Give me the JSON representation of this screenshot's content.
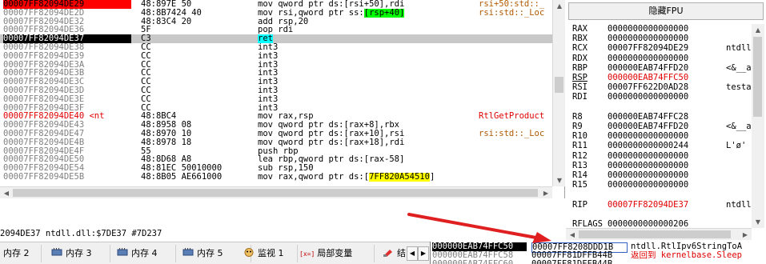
{
  "disasm": {
    "rows": [
      {
        "addr": "00007FF82094DE29",
        "bytes": "48:897E 50",
        "ins": [
          {
            "t": "mov qword ptr ds:[rsi+50],rdi"
          }
        ],
        "cmt": "rsi+50:std::_",
        "style": "bp"
      },
      {
        "addr": "00007FF82094DE2D",
        "bytes": "48:8B7424 40",
        "ins": [
          {
            "t": "mov rsi,qword ptr ss:"
          },
          {
            "t": "[rsp+40]",
            "hl": "green"
          }
        ],
        "cmt": "rsi:std::_Loc",
        "style": "normal"
      },
      {
        "addr": "00007FF82094DE32",
        "bytes": "48:83C4 20",
        "ins": [
          {
            "t": "add rsp,20"
          }
        ],
        "cmt": "",
        "style": "normal"
      },
      {
        "addr": "00007FF82094DE36",
        "bytes": "5F",
        "ins": [
          {
            "t": "pop rdi"
          }
        ],
        "cmt": "",
        "style": "normal"
      },
      {
        "addr": "00007FF82094DE37",
        "bytes": "C3",
        "ins": [
          {
            "t": "ret",
            "hl": "cyan"
          }
        ],
        "cmt": "",
        "style": "current"
      },
      {
        "addr": "00007FF82094DE38",
        "bytes": "CC",
        "ins": [
          {
            "t": "int3"
          }
        ],
        "cmt": "",
        "style": "normal"
      },
      {
        "addr": "00007FF82094DE39",
        "bytes": "CC",
        "ins": [
          {
            "t": "int3"
          }
        ],
        "cmt": "",
        "style": "normal"
      },
      {
        "addr": "00007FF82094DE3A",
        "bytes": "CC",
        "ins": [
          {
            "t": "int3"
          }
        ],
        "cmt": "",
        "style": "normal"
      },
      {
        "addr": "00007FF82094DE3B",
        "bytes": "CC",
        "ins": [
          {
            "t": "int3"
          }
        ],
        "cmt": "",
        "style": "normal"
      },
      {
        "addr": "00007FF82094DE3C",
        "bytes": "CC",
        "ins": [
          {
            "t": "int3"
          }
        ],
        "cmt": "",
        "style": "normal"
      },
      {
        "addr": "00007FF82094DE3D",
        "bytes": "CC",
        "ins": [
          {
            "t": "int3"
          }
        ],
        "cmt": "",
        "style": "normal"
      },
      {
        "addr": "00007FF82094DE3E",
        "bytes": "CC",
        "ins": [
          {
            "t": "int3"
          }
        ],
        "cmt": "",
        "style": "normal"
      },
      {
        "addr": "00007FF82094DE3F",
        "bytes": "CC",
        "ins": [
          {
            "t": "int3"
          }
        ],
        "cmt": "",
        "style": "normal"
      },
      {
        "addr": "00007FF82094DE40 <nt",
        "bytes": "48:8BC4",
        "ins": [
          {
            "t": "mov rax,rsp"
          }
        ],
        "cmt": "RtlGetProduct",
        "style": "label"
      },
      {
        "addr": "00007FF82094DE43",
        "bytes": "48:8958 08",
        "ins": [
          {
            "t": "mov qword ptr ds:[rax+8],rbx"
          }
        ],
        "cmt": "",
        "style": "normal"
      },
      {
        "addr": "00007FF82094DE47",
        "bytes": "48:8970 10",
        "ins": [
          {
            "t": "mov qword ptr ds:[rax+10],rsi"
          }
        ],
        "cmt": "rsi:std::_Loc",
        "style": "normal"
      },
      {
        "addr": "00007FF82094DE4B",
        "bytes": "48:8978 18",
        "ins": [
          {
            "t": "mov qword ptr ds:[rax+18],rdi"
          }
        ],
        "cmt": "",
        "style": "normal"
      },
      {
        "addr": "00007FF82094DE4F",
        "bytes": "55",
        "ins": [
          {
            "t": "push rbp"
          }
        ],
        "cmt": "",
        "style": "normal"
      },
      {
        "addr": "00007FF82094DE50",
        "bytes": "48:8D68 A8",
        "ins": [
          {
            "t": "lea rbp,qword ptr ds:[rax-58]"
          }
        ],
        "cmt": "",
        "style": "normal"
      },
      {
        "addr": "00007FF82094DE54",
        "bytes": "48:81EC 50010000",
        "ins": [
          {
            "t": "sub rsp,150"
          }
        ],
        "cmt": "",
        "style": "normal"
      },
      {
        "addr": "00007FF82094DE5B",
        "bytes": "48:8B05 AE661000",
        "ins": [
          {
            "t": "mov rax,qword ptr ds:["
          },
          {
            "t": "7FF820A54510",
            "hl": "yellow"
          },
          {
            "t": "]"
          }
        ],
        "cmt": "",
        "style": "normal"
      }
    ]
  },
  "registers": {
    "fpu_button": "隐藏FPU",
    "rows": [
      {
        "name": "RAX",
        "value": "0000000000000000",
        "cmt": "",
        "color": "normal"
      },
      {
        "name": "RBX",
        "value": "0000000000000000",
        "cmt": "",
        "color": "normal"
      },
      {
        "name": "RCX",
        "value": "00007FF82094DE29",
        "cmt": "ntdll",
        "color": "normal"
      },
      {
        "name": "RDX",
        "value": "0000000000000000",
        "cmt": "",
        "color": "normal"
      },
      {
        "name": "RBP",
        "value": "000000EAB74FFD20",
        "cmt": "<&__a",
        "color": "normal"
      },
      {
        "name": "RSP",
        "value": "000000EAB74FFC50",
        "cmt": "",
        "color": "red"
      },
      {
        "name": "RSI",
        "value": "00007FF622D0AD28",
        "cmt": "testa",
        "color": "normal"
      },
      {
        "name": "RDI",
        "value": "0000000000000000",
        "cmt": "",
        "color": "normal"
      },
      {
        "name": "",
        "value": "",
        "cmt": "",
        "color": "normal"
      },
      {
        "name": "R8",
        "value": "000000EAB74FFC28",
        "cmt": "",
        "color": "normal"
      },
      {
        "name": "R9",
        "value": "000000EAB74FFD20",
        "cmt": "<&__a",
        "color": "normal"
      },
      {
        "name": "R10",
        "value": "0000000000000000",
        "cmt": "",
        "color": "normal"
      },
      {
        "name": "R11",
        "value": "0000000000000244",
        "cmt": "L'ø'",
        "color": "normal"
      },
      {
        "name": "R12",
        "value": "0000000000000000",
        "cmt": "",
        "color": "normal"
      },
      {
        "name": "R13",
        "value": "0000000000000000",
        "cmt": "",
        "color": "normal"
      },
      {
        "name": "R14",
        "value": "0000000000000000",
        "cmt": "",
        "color": "normal"
      },
      {
        "name": "R15",
        "value": "0000000000000000",
        "cmt": "",
        "color": "normal"
      },
      {
        "name": "",
        "value": "",
        "cmt": "",
        "color": "normal"
      },
      {
        "name": "RIP",
        "value": "00007FF82094DE37",
        "cmt": "ntdll",
        "color": "red"
      },
      {
        "name": "",
        "value": "",
        "cmt": "",
        "color": "normal"
      },
      {
        "name": "RFLAGS",
        "value": "0000000000000206",
        "cmt": "",
        "color": "normal"
      }
    ]
  },
  "status": {
    "text": "2094DE37 ntdll.dll:$7DE37 #7D237"
  },
  "tabs": [
    {
      "label": "内存 2",
      "icon": "memory-icon"
    },
    {
      "label": "内存 3",
      "icon": "memory-icon"
    },
    {
      "label": "内存 4",
      "icon": "memory-icon"
    },
    {
      "label": "内存 5",
      "icon": "memory-icon"
    },
    {
      "label": "监视 1",
      "icon": "watch-icon"
    },
    {
      "label": "局部变量",
      "icon": "locals-icon"
    },
    {
      "label": "结",
      "icon": "struct-icon"
    }
  ],
  "locals_icon_text": "[x=]",
  "nav": {
    "prev": "◀",
    "next": "▶"
  },
  "stack": {
    "rows": [
      {
        "addr": "000000EAB74FFC50",
        "value": "00007FF8208DDD1B",
        "cmt": "ntdll.RtlIpv6StringToA",
        "selected": true
      },
      {
        "addr": "000000EAB74FFC58",
        "value": "00007FF81DFFB44B",
        "cmt": "返回到 kernelbase.Sleep",
        "selected": false
      },
      {
        "addr": "000000EAB74FFC60",
        "value": "00007FF81DFFB44B",
        "cmt": "",
        "selected": false
      }
    ]
  },
  "colors": {
    "accent_red": "#e00000",
    "current_row": "#000000",
    "bp_row": "#ff0000",
    "arrow": "#e02020"
  }
}
